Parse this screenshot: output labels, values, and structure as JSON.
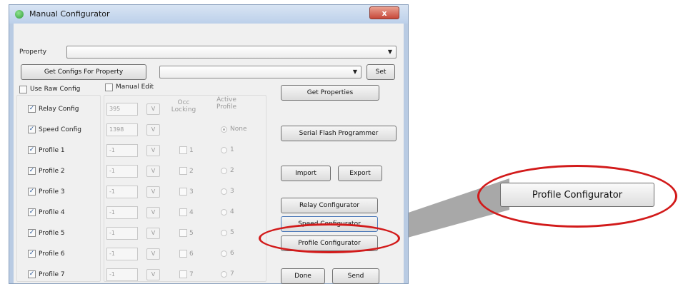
{
  "window": {
    "title": "Manual Configurator",
    "close_glyph": "x"
  },
  "property": {
    "label": "Property",
    "value": ""
  },
  "toolbar": {
    "get_configs": "Get Configs For Property",
    "config_value": "",
    "set": "Set"
  },
  "options": {
    "use_raw_config": "Use Raw Config",
    "manual_edit": "Manual Edit"
  },
  "headers": {
    "occ_locking": "Occ Locking",
    "active_profile": "Active Profile"
  },
  "rows": [
    {
      "label": "Relay Config",
      "value": "395",
      "v": "V",
      "checked": true
    },
    {
      "label": "Speed Config",
      "value": "1398",
      "v": "V",
      "checked": true,
      "active": "None"
    },
    {
      "label": "Profile 1",
      "value": "-1",
      "v": "V",
      "checked": true,
      "occ": "1",
      "active": "1"
    },
    {
      "label": "Profile 2",
      "value": "-1",
      "v": "V",
      "checked": true,
      "occ": "2",
      "active": "2"
    },
    {
      "label": "Profile 3",
      "value": "-1",
      "v": "V",
      "checked": true,
      "occ": "3",
      "active": "3"
    },
    {
      "label": "Profile 4",
      "value": "-1",
      "v": "V",
      "checked": true,
      "occ": "4",
      "active": "4"
    },
    {
      "label": "Profile 5",
      "value": "-1",
      "v": "V",
      "checked": true,
      "occ": "5",
      "active": "5"
    },
    {
      "label": "Profile 6",
      "value": "-1",
      "v": "V",
      "checked": true,
      "occ": "6",
      "active": "6"
    },
    {
      "label": "Profile 7",
      "value": "-1",
      "v": "V",
      "checked": true,
      "occ": "7",
      "active": "7"
    }
  ],
  "buttons": {
    "get_properties": "Get Properties",
    "serial_flash": "Serial Flash Programmer",
    "import": "Import",
    "export": "Export",
    "relay_configurator": "Relay Configurator",
    "speed_configurator": "Speed Configurator",
    "profile_configurator": "Profile Configurator",
    "done": "Done",
    "send": "Send"
  },
  "callout": {
    "label": "Profile Configurator"
  },
  "colors": {
    "highlight": "#d21a1a",
    "callout_wedge": "#9e9e9e",
    "check": "#2d5b9a"
  },
  "icons": {
    "app": "green-circle-icon",
    "check": "check-mark-icon",
    "dropdown": "chevron-down-icon"
  }
}
